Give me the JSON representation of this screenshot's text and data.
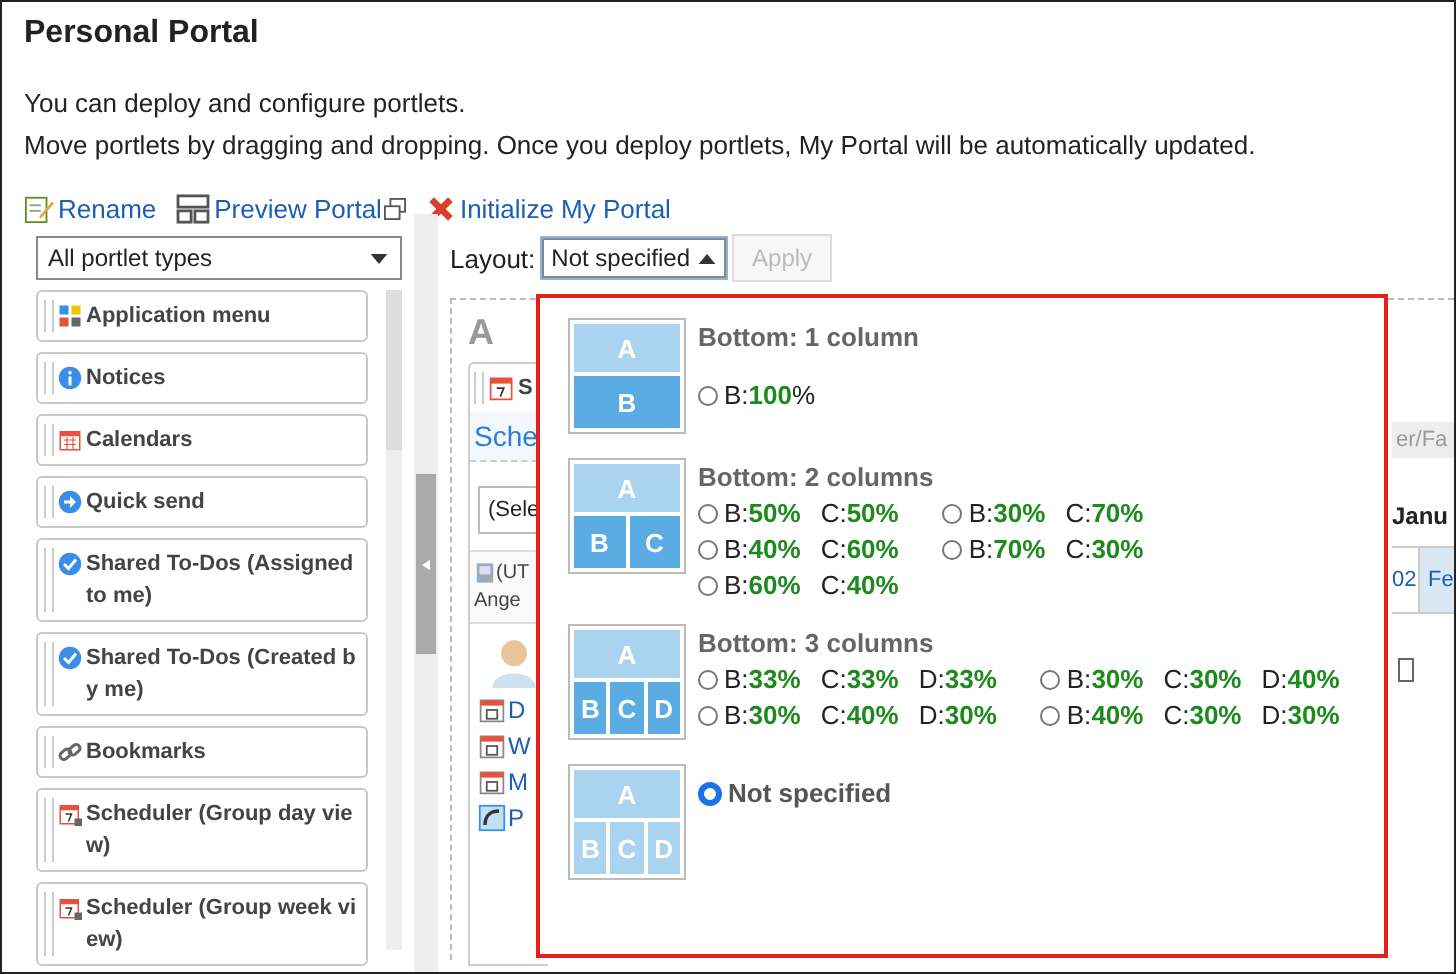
{
  "title": "Personal Portal",
  "description": [
    "You can deploy and configure portlets.",
    "Move portlets by dragging and dropping. Once you deploy portlets, My Portal will be automatically updated."
  ],
  "toolbar": [
    {
      "label": "Rename",
      "kind": "rename"
    },
    {
      "label": "Preview Portal",
      "kind": "preview"
    },
    {
      "label": "Initialize My Portal",
      "kind": "initialize"
    }
  ],
  "portlet_filter": {
    "value": "All portlet types"
  },
  "portlets": [
    {
      "label": "Application menu",
      "kind": "apps"
    },
    {
      "label": "Notices",
      "kind": "info"
    },
    {
      "label": "Calendars",
      "kind": "calendar"
    },
    {
      "label": "Quick send",
      "kind": "send"
    },
    {
      "label": "Shared To-Dos (Assigned to me)",
      "kind": "todo"
    },
    {
      "label": "Shared To-Dos (Created by me)",
      "kind": "todo"
    },
    {
      "label": "Bookmarks",
      "kind": "link"
    },
    {
      "label": "Scheduler (Group day view)",
      "kind": "schedule"
    },
    {
      "label": "Scheduler (Group week view)",
      "kind": "schedule"
    }
  ],
  "layout": {
    "label": "Layout:",
    "value": "Not specified",
    "apply": "Apply",
    "apply_disabled": true
  },
  "layout_menu": [
    {
      "kind": "columns",
      "title": "Bottom: 1 column",
      "preview": {
        "top": "A",
        "bottom": [
          "B"
        ],
        "dim": false
      },
      "options": [
        {
          "selected": false,
          "parts": [
            "B:**100**%"
          ]
        }
      ]
    },
    {
      "kind": "columns",
      "title": "Bottom: 2 columns",
      "preview": {
        "top": "A",
        "bottom": [
          "B",
          "C"
        ],
        "dim": false
      },
      "options": [
        {
          "selected": false,
          "parts": [
            "B:**50%**",
            "C:**50%**"
          ]
        },
        {
          "selected": false,
          "parts": [
            "B:**30%**",
            "C:**70%**"
          ]
        },
        {
          "selected": false,
          "parts": [
            "B:**40%**",
            "C:**60%**"
          ]
        },
        {
          "selected": false,
          "parts": [
            "B:**70%**",
            "C:**30%**"
          ]
        },
        {
          "selected": false,
          "parts": [
            "B:**60%**",
            "C:**40%**"
          ]
        }
      ]
    },
    {
      "kind": "columns",
      "title": "Bottom: 3 columns",
      "preview": {
        "top": "A",
        "bottom": [
          "B",
          "C",
          "D"
        ],
        "dim": false
      },
      "options": [
        {
          "selected": false,
          "parts": [
            "B:**33%**",
            "C:**33%**",
            "D:**33%**"
          ]
        },
        {
          "selected": false,
          "parts": [
            "B:**30%**",
            "C:**30%**",
            "D:**40%**"
          ]
        },
        {
          "selected": false,
          "parts": [
            "B:**30%**",
            "C:**40%**",
            "D:**30%**"
          ]
        },
        {
          "selected": false,
          "parts": [
            "B:**40%**",
            "C:**30%**",
            "D:**30%**"
          ]
        }
      ]
    },
    {
      "kind": "none",
      "preview": {
        "top": "A",
        "bottom": [
          "B",
          "C",
          "D"
        ],
        "dim": true
      },
      "options": [
        {
          "selected": true,
          "label": "Not specified"
        }
      ]
    }
  ],
  "background": {
    "area_label": "A",
    "portlet_title": "S",
    "tab": "Sche",
    "select": "(Sele",
    "timezone": "(UT",
    "user": "Ange",
    "links": [
      "D",
      "W",
      "M",
      "P"
    ],
    "right_tab": "er/Fa",
    "month": "Janu",
    "day": "02",
    "day_next": "Fe"
  }
}
